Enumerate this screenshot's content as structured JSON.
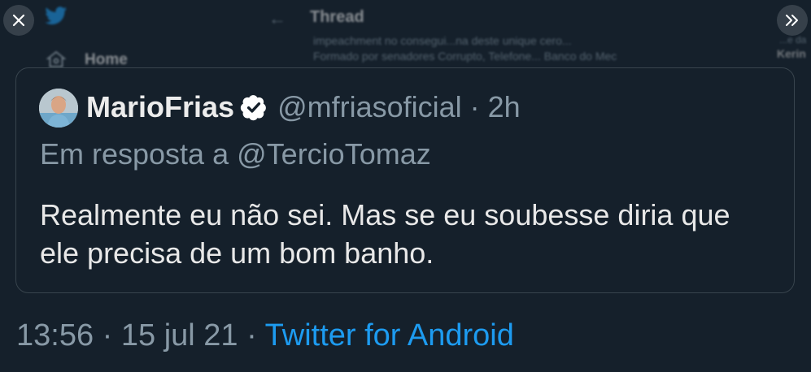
{
  "background": {
    "title": "Thread",
    "nav_home": "Home",
    "blurred_line_1": "impeachment no consegui...na deste unique cero...",
    "blurred_line_2": "Formado por senadores Corrupto, Telefone... Banco do Mec",
    "right_line_1": "...e da",
    "right_line_2": "Kerin"
  },
  "overlay": {
    "close_icon": "close-icon",
    "expand_icon": "chevron-double-right-icon"
  },
  "tweet": {
    "author_name": "MarioFrias",
    "verified": true,
    "handle": "@mfriasoficial",
    "time_ago": "2h",
    "reply_prefix": "Em resposta a",
    "reply_to": "@TercioTomaz",
    "text": "Realmente eu não sei. Mas se eu soubesse diria que ele precisa de um bom banho."
  },
  "footer": {
    "time": "13:56",
    "date": "15 jul 21",
    "source": "Twitter for Android"
  },
  "colors": {
    "background": "#15202b",
    "accent": "#1d9bf0",
    "muted": "#8899a6"
  }
}
